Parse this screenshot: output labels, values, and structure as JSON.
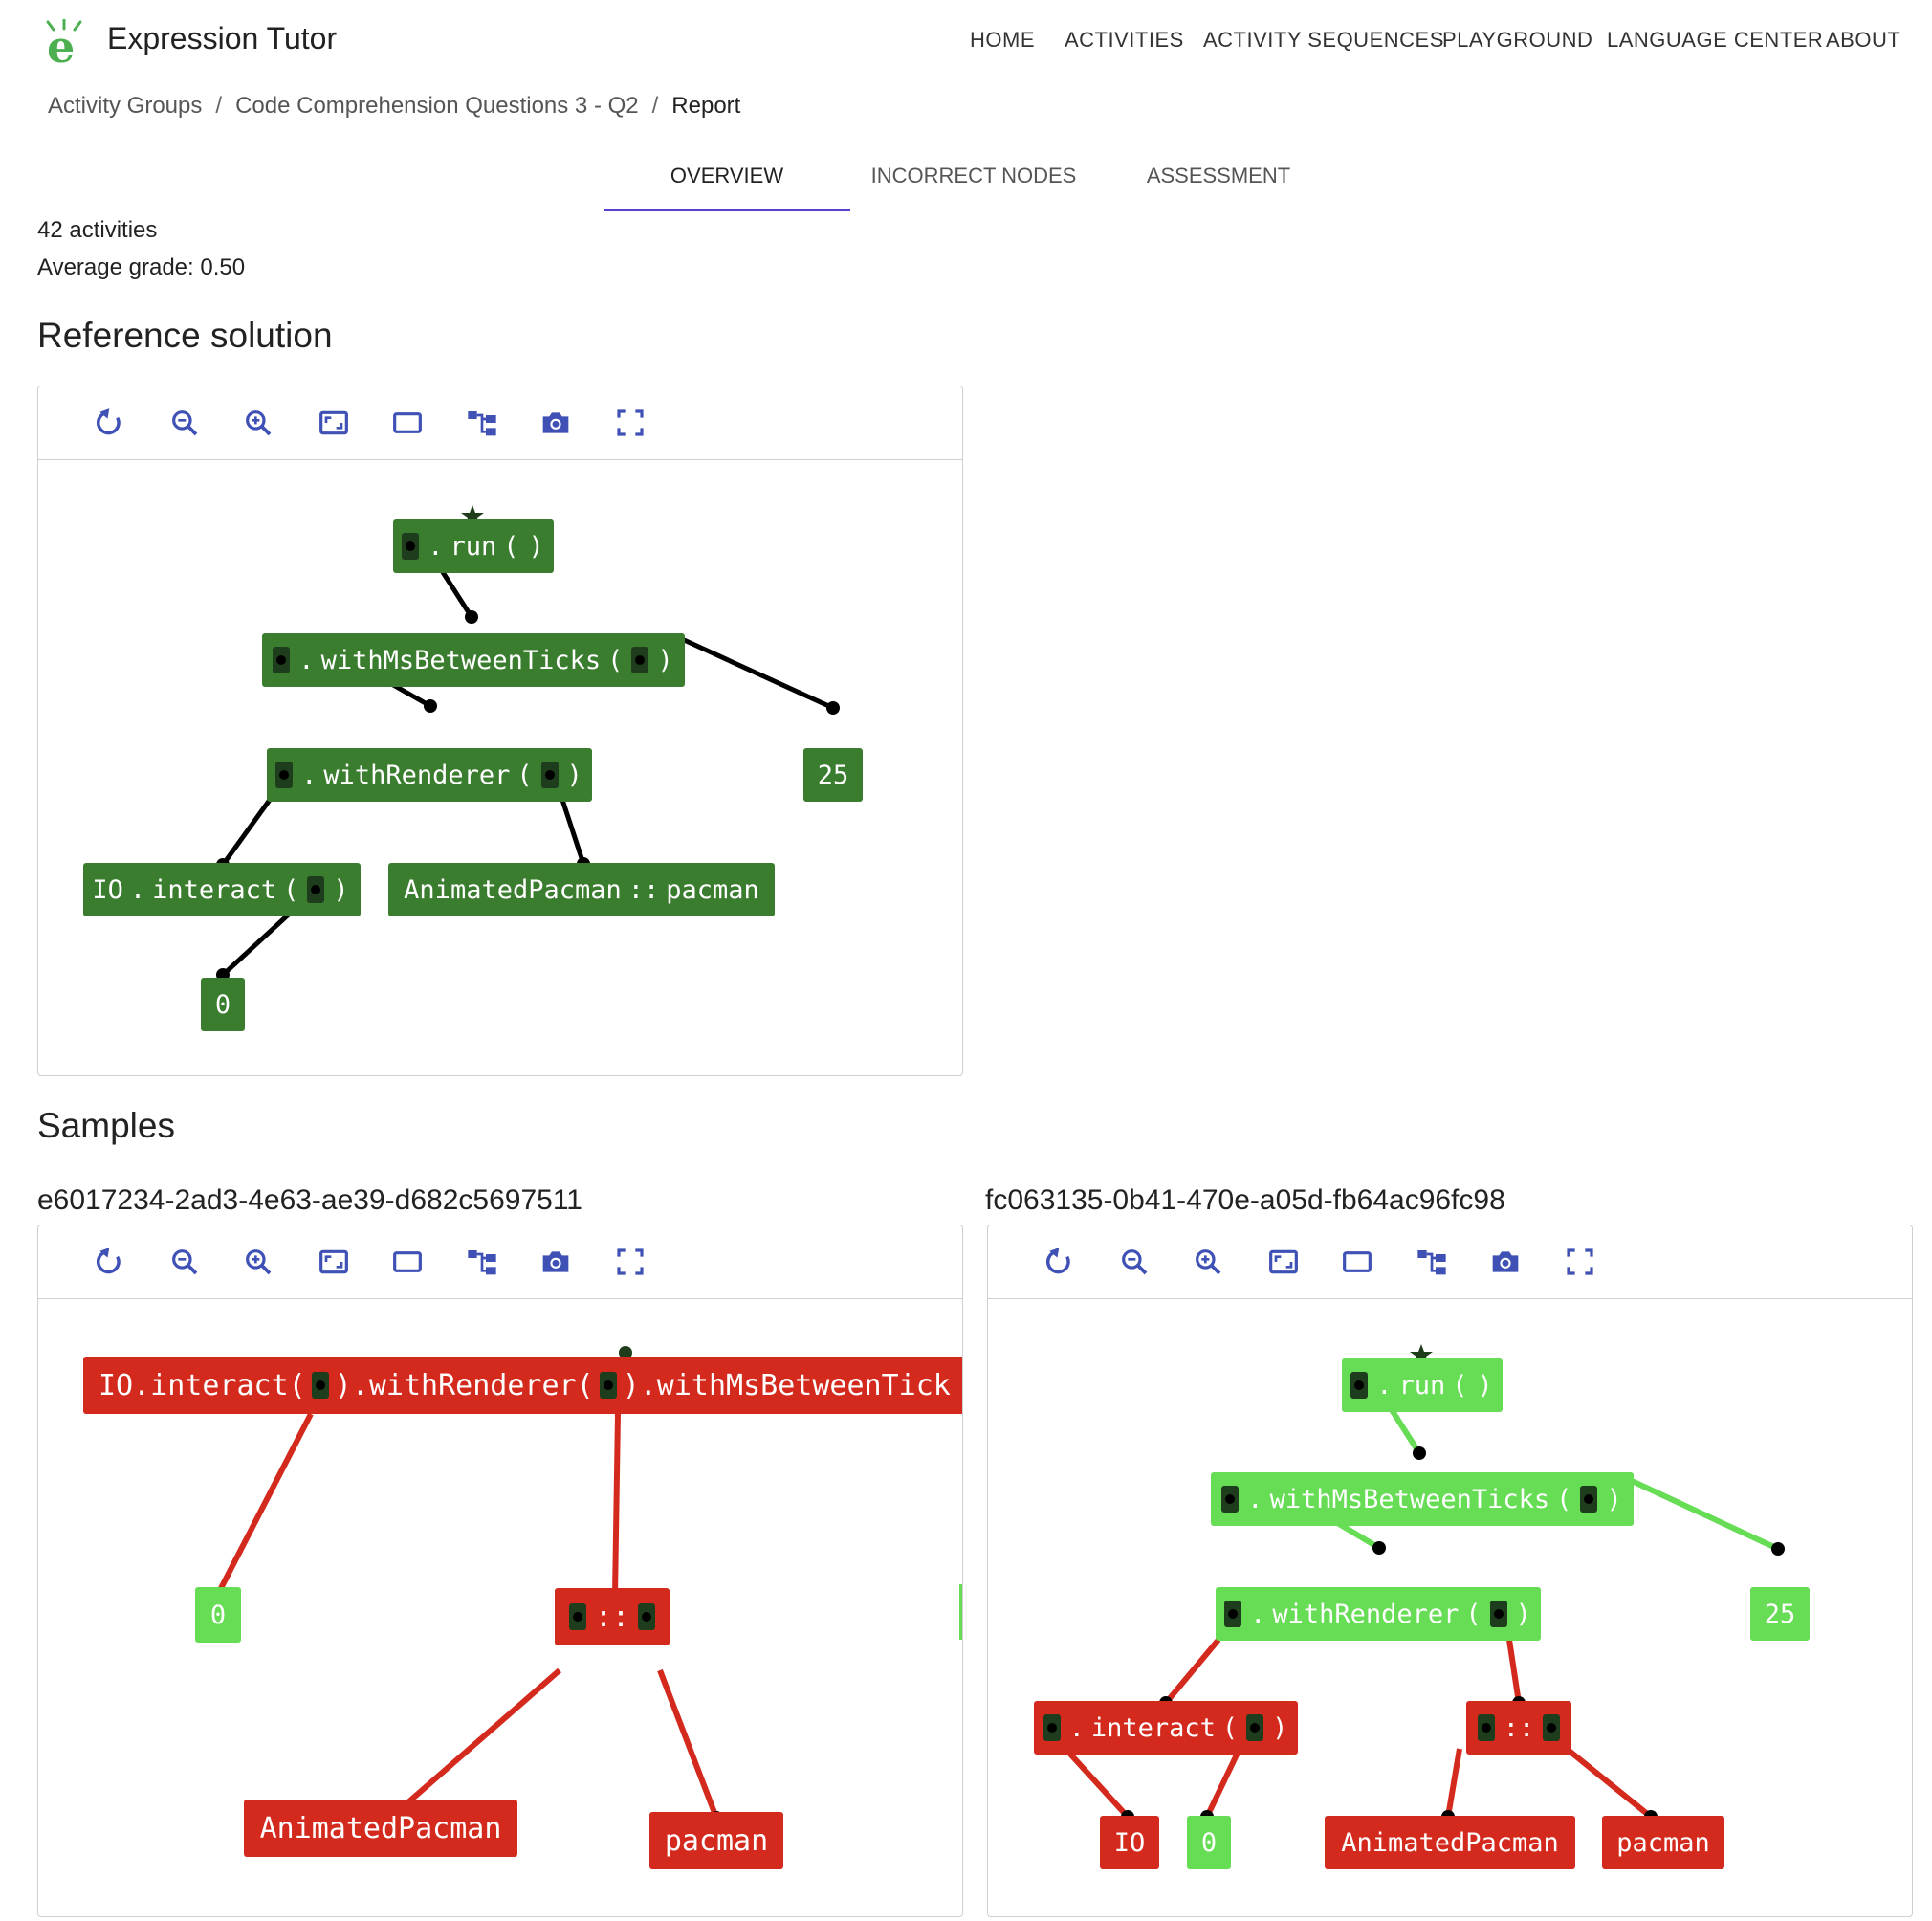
{
  "app": {
    "title": "Expression Tutor"
  },
  "nav": [
    "HOME",
    "ACTIVITIES",
    "ACTIVITY SEQUENCES",
    "PLAYGROUND",
    "LANGUAGE CENTER",
    "ABOUT"
  ],
  "breadcrumb": [
    "Activity Groups",
    "Code Comprehension Questions 3 - Q2",
    "Report"
  ],
  "tabs": [
    {
      "label": "OVERVIEW",
      "active": true
    },
    {
      "label": "INCORRECT NODES",
      "active": false
    },
    {
      "label": "ASSESSMENT",
      "active": false
    }
  ],
  "stats": {
    "activities": "42 activities",
    "average_grade": "Average grade: 0.50"
  },
  "sections": {
    "reference": "Reference solution",
    "samples": "Samples"
  },
  "toolbar_icons": [
    "reset-icon",
    "zoom-out-icon",
    "zoom-in-icon",
    "fit-icon",
    "frame-icon",
    "layout-tree-icon",
    "camera-icon",
    "fullscreen-icon"
  ],
  "colors": {
    "accent": "#3f51b5",
    "tab_indicator": "#5b3fcf",
    "correct_dark": "#3b7d2f",
    "correct_light": "#66dd55",
    "incorrect": "#d42a1e"
  },
  "reference_tree": {
    "nodes": {
      "run": {
        "parts": [
          "●",
          ".",
          "run",
          "(",
          ")"
        ]
      },
      "ticks": {
        "parts": [
          "●",
          ".",
          "withMsBetweenTicks",
          "(",
          "●",
          ")"
        ]
      },
      "renderer": {
        "parts": [
          "●",
          ".",
          "withRenderer",
          "(",
          "●",
          ")"
        ]
      },
      "n25": {
        "parts": [
          "25"
        ]
      },
      "interact": {
        "parts": [
          "IO",
          ".",
          "interact",
          "(",
          "●",
          ")"
        ]
      },
      "pacman": {
        "parts": [
          "AnimatedPacman",
          "::",
          "pacman"
        ]
      },
      "n0": {
        "parts": [
          "0"
        ]
      }
    }
  },
  "samples": [
    {
      "id": "e6017234-2ad3-4e63-ae39-d682c5697511",
      "nodes": {
        "chain": {
          "parts": [
            "IO.interact(",
            "●",
            ").withRenderer(",
            "●",
            ").withMsBetweenTick"
          ]
        },
        "n0": {
          "parts": [
            "0"
          ]
        },
        "dcolon": {
          "parts": [
            "●",
            "::",
            "●"
          ]
        },
        "animated": {
          "parts": [
            "AnimatedPacman"
          ]
        },
        "pacman": {
          "parts": [
            "pacman"
          ]
        }
      }
    },
    {
      "id": "fc063135-0b41-470e-a05d-fb64ac96fc98",
      "nodes": {
        "run": {
          "parts": [
            "●",
            ".",
            "run",
            "(",
            ")"
          ]
        },
        "ticks": {
          "parts": [
            "●",
            ".",
            "withMsBetweenTicks",
            "(",
            "●",
            ")"
          ]
        },
        "renderer": {
          "parts": [
            "●",
            ".",
            "withRenderer",
            "(",
            "●",
            ")"
          ]
        },
        "n25": {
          "parts": [
            "25"
          ]
        },
        "interact": {
          "parts": [
            "●",
            ".",
            "interact",
            "(",
            "●",
            ")"
          ]
        },
        "dcolon": {
          "parts": [
            "●",
            "::",
            "●"
          ]
        },
        "io": {
          "parts": [
            "IO"
          ]
        },
        "n0": {
          "parts": [
            "0"
          ]
        },
        "animated": {
          "parts": [
            "AnimatedPacman"
          ]
        },
        "pacman": {
          "parts": [
            "pacman"
          ]
        }
      }
    }
  ]
}
